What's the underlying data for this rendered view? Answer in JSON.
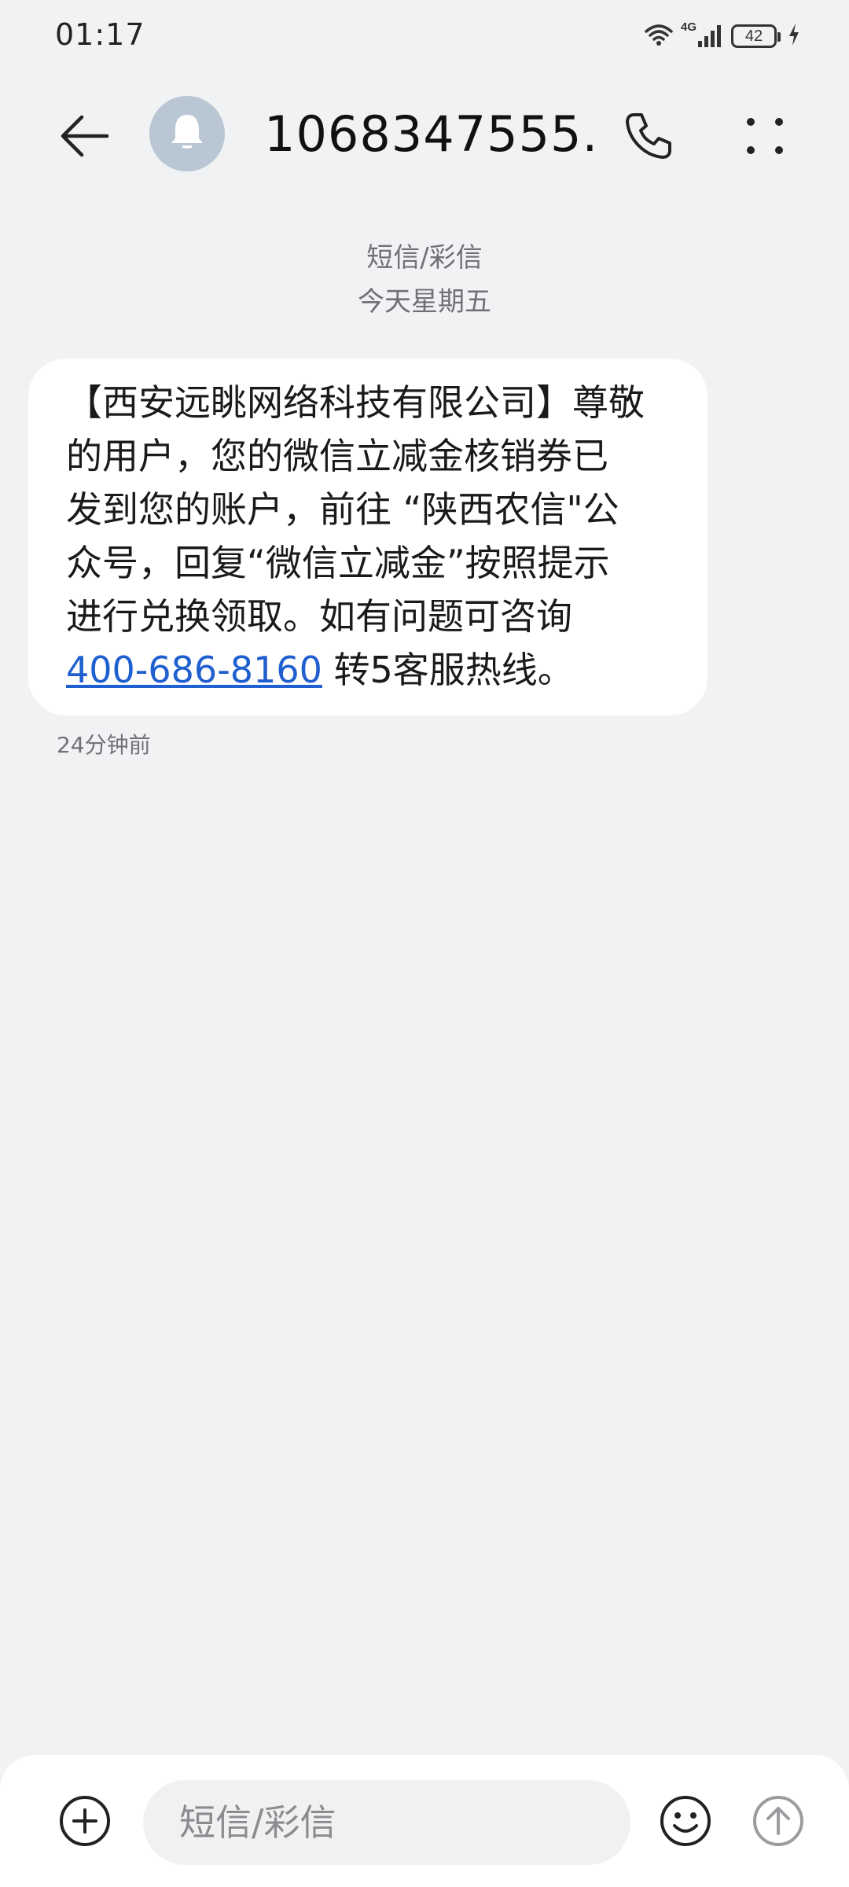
{
  "status_bar": {
    "time": "01:17",
    "network_label": "4G",
    "battery_level": "42"
  },
  "header": {
    "contact_name": "1068347555...",
    "back_icon": "arrow-left-icon",
    "avatar_icon": "bell-icon",
    "call_icon": "phone-icon",
    "more_icon": "more-dots-icon"
  },
  "thread": {
    "type_label": "短信/彩信",
    "date_label": "今天星期五"
  },
  "messages": [
    {
      "text_lines": [
        "【西安远眺网络科技有限公司】尊敬",
        "的用户，您的微信立减金核销券已",
        "发到您的账户，前往 “陕西农信\"公",
        "众号，回复“微信立减金”按照提示",
        "进行兑换领取。如有问题可咨询"
      ],
      "phone_link": "400-686-8160",
      "text_tail": " 转5客服热线。",
      "time_label": "24分钟前"
    }
  ],
  "composer": {
    "placeholder": "短信/彩信",
    "add_icon": "plus-circle-icon",
    "emoji_icon": "smiley-icon",
    "send_icon": "send-arrow-icon"
  },
  "colors": {
    "background": "#f1f2f4",
    "bubble": "#ffffff",
    "link": "#1f5fcf",
    "avatar": "#b9c6d3"
  }
}
